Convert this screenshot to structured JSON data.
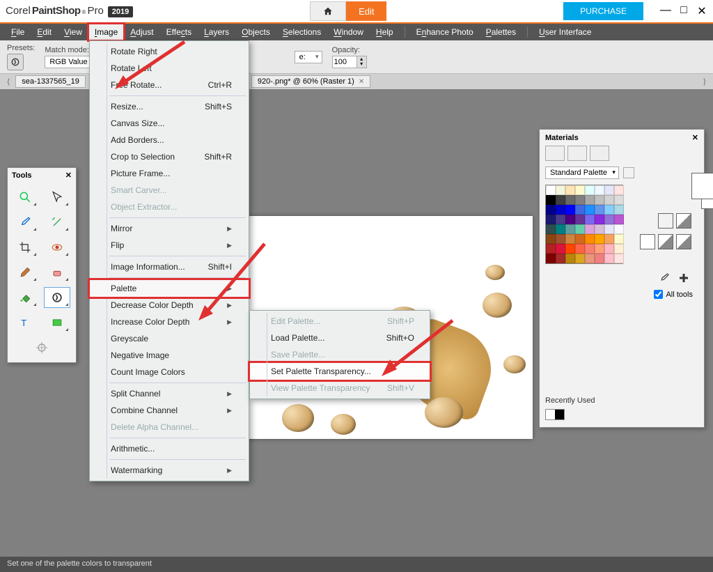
{
  "app": {
    "brand": "Corel",
    "name": "PaintShop",
    "suffix": "Pro",
    "year": "2019",
    "editTab": "Edit",
    "purchase": "PURCHASE"
  },
  "menubar": [
    "File",
    "Edit",
    "View",
    "Image",
    "Adjust",
    "Effects",
    "Layers",
    "Objects",
    "Selections",
    "Window",
    "Help",
    "Enhance Photo",
    "Palettes",
    "User Interface"
  ],
  "options": {
    "presets": "Presets:",
    "matchMode": "Match mode:",
    "matchVal": "RGB Value",
    "opacity": "Opacity:",
    "opacityVal": "100"
  },
  "docs": {
    "tab1": "sea-1337565_19",
    "tab2": "920-.png* @  60% (Raster 1)"
  },
  "toolsTitle": "Tools",
  "imageMenu": {
    "rotateRight": "Rotate Right",
    "rotateLeft": "Rotate Left",
    "freeRotate": "Free Rotate...",
    "freeRotateK": "Ctrl+R",
    "resize": "Resize...",
    "resizeK": "Shift+S",
    "canvas": "Canvas Size...",
    "borders": "Add Borders...",
    "crop": "Crop to Selection",
    "cropK": "Shift+R",
    "frame": "Picture Frame...",
    "carver": "Smart Carver...",
    "extract": "Object Extractor...",
    "mirror": "Mirror",
    "flip": "Flip",
    "info": "Image Information...",
    "infoK": "Shift+I",
    "palette": "Palette",
    "decDepth": "Decrease Color Depth",
    "incDepth": "Increase Color Depth",
    "grey": "Greyscale",
    "neg": "Negative Image",
    "count": "Count Image Colors",
    "split": "Split Channel",
    "combine": "Combine Channel",
    "delAlpha": "Delete Alpha Channel...",
    "arith": "Arithmetic...",
    "water": "Watermarking"
  },
  "paletteMenu": {
    "edit": "Edit Palette...",
    "editK": "Shift+P",
    "load": "Load Palette...",
    "loadK": "Shift+O",
    "save": "Save Palette...",
    "setTrans": "Set Palette Transparency...",
    "viewTrans": "View Palette Transparency",
    "viewTransK": "Shift+V"
  },
  "materials": {
    "title": "Materials",
    "stdPalette": "Standard Palette",
    "allTools": "All tools",
    "recent": "Recently Used"
  },
  "paletteColors": [
    "#ffffff",
    "#f5f5dc",
    "#ffe4b5",
    "#fffacd",
    "#e0ffff",
    "#f0f8ff",
    "#e6e6fa",
    "#ffe4e1",
    "#000000",
    "#404040",
    "#696969",
    "#808080",
    "#a9a9a9",
    "#c0c0c0",
    "#d3d3d3",
    "#dcdcdc",
    "#00008b",
    "#0000cd",
    "#0000ff",
    "#4169e1",
    "#1e90ff",
    "#6495ed",
    "#87cefa",
    "#add8e6",
    "#191970",
    "#483d8b",
    "#4b0082",
    "#663399",
    "#7b68ee",
    "#8a2be2",
    "#9370db",
    "#ba55d3",
    "#2f4f4f",
    "#008080",
    "#5f9ea0",
    "#66cdaa",
    "#dda0dd",
    "#d8bfd8",
    "#e6e6fa",
    "#f8f8ff",
    "#8b4513",
    "#a0522d",
    "#cd853f",
    "#d2691e",
    "#ff8c00",
    "#ffa500",
    "#f4a460",
    "#fffacd",
    "#b22222",
    "#dc143c",
    "#ff4500",
    "#ff6347",
    "#fa8072",
    "#ffa07a",
    "#ffb6c1",
    "#ffefd5",
    "#800000",
    "#a52a2a",
    "#b8860b",
    "#daa520",
    "#e9967a",
    "#f08080",
    "#ffc0cb",
    "#ffe4e1"
  ],
  "status": "Set one of the palette colors to transparent"
}
